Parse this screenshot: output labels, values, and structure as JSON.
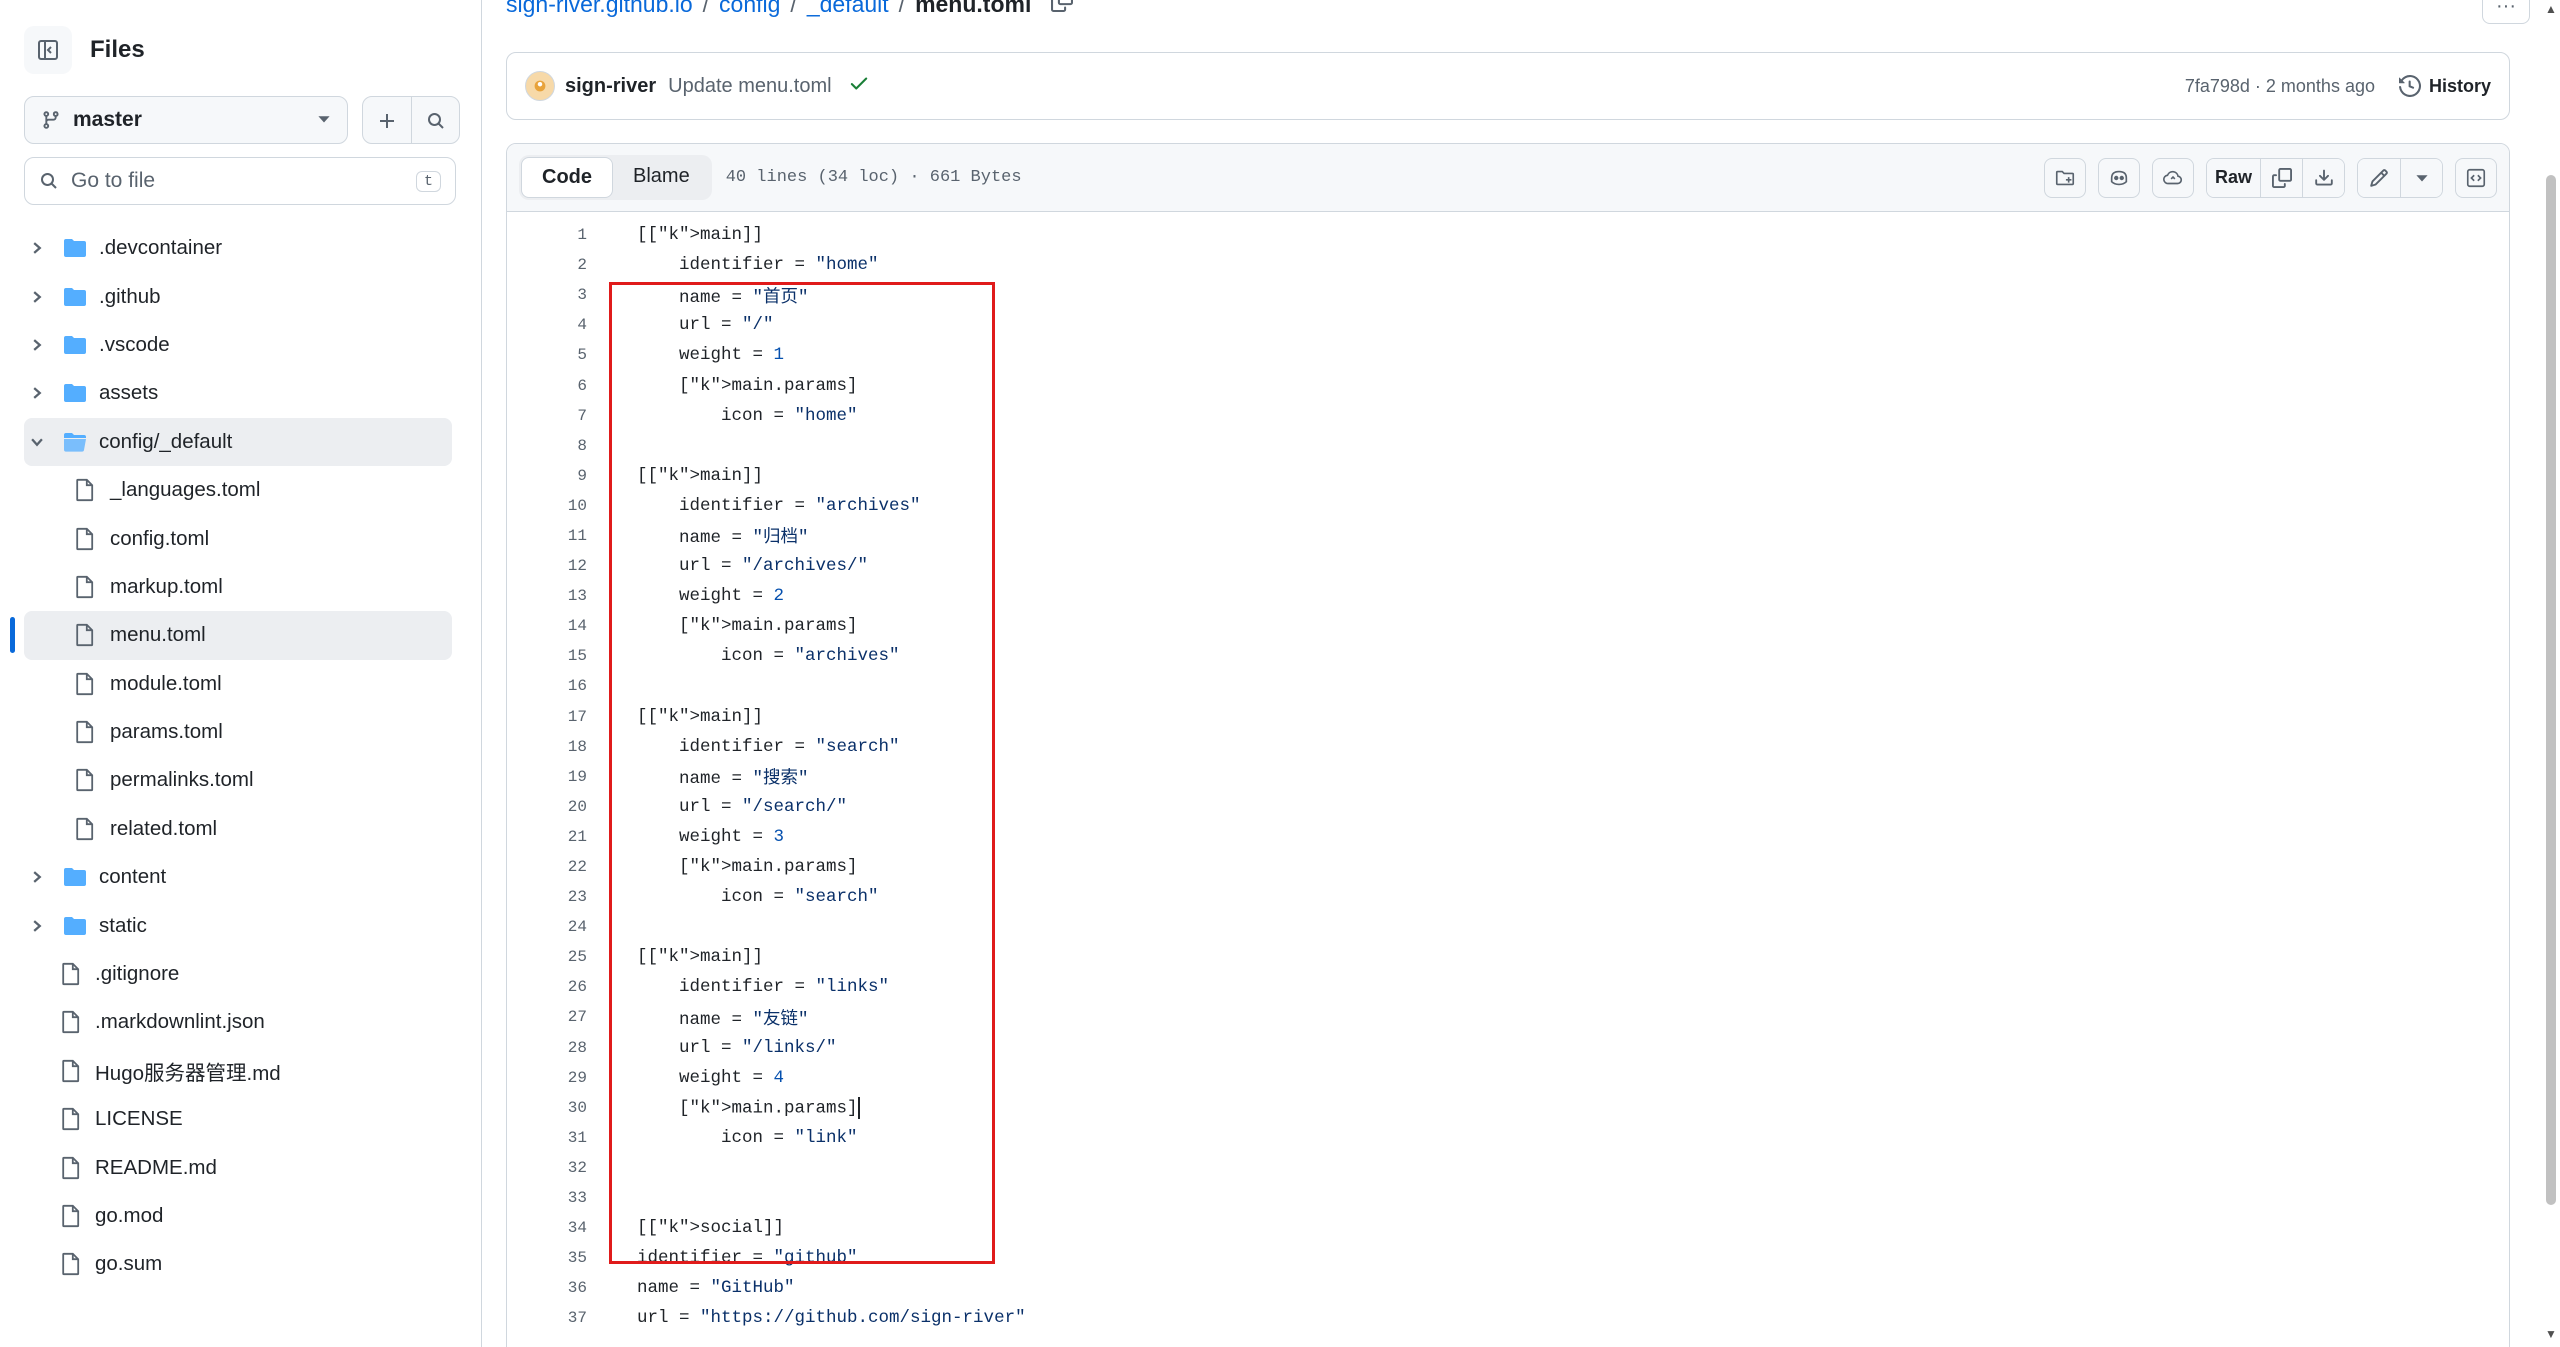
{
  "sidebar": {
    "title": "Files",
    "branch": "master",
    "search_placeholder": "Go to file",
    "search_shortcut": "t",
    "tree": [
      {
        "label": ".devcontainer",
        "type": "folder",
        "level": 0,
        "expanded": false
      },
      {
        "label": ".github",
        "type": "folder",
        "level": 0,
        "expanded": false
      },
      {
        "label": ".vscode",
        "type": "folder",
        "level": 0,
        "expanded": false
      },
      {
        "label": "assets",
        "type": "folder",
        "level": 0,
        "expanded": false
      },
      {
        "label": "config/_default",
        "type": "folder",
        "level": 0,
        "expanded": true
      },
      {
        "label": "_languages.toml",
        "type": "file",
        "level": 1
      },
      {
        "label": "config.toml",
        "type": "file",
        "level": 1
      },
      {
        "label": "markup.toml",
        "type": "file",
        "level": 1
      },
      {
        "label": "menu.toml",
        "type": "file",
        "level": 1,
        "selected": true
      },
      {
        "label": "module.toml",
        "type": "file",
        "level": 1
      },
      {
        "label": "params.toml",
        "type": "file",
        "level": 1
      },
      {
        "label": "permalinks.toml",
        "type": "file",
        "level": 1
      },
      {
        "label": "related.toml",
        "type": "file",
        "level": 1
      },
      {
        "label": "content",
        "type": "folder",
        "level": 0,
        "expanded": false
      },
      {
        "label": "static",
        "type": "folder",
        "level": 0,
        "expanded": false
      },
      {
        "label": ".gitignore",
        "type": "file",
        "level": 0
      },
      {
        "label": ".markdownlint.json",
        "type": "file",
        "level": 0
      },
      {
        "label": "Hugo服务器管理.md",
        "type": "file",
        "level": 0
      },
      {
        "label": "LICENSE",
        "type": "file",
        "level": 0
      },
      {
        "label": "README.md",
        "type": "file",
        "level": 0
      },
      {
        "label": "go.mod",
        "type": "file",
        "level": 0
      },
      {
        "label": "go.sum",
        "type": "file",
        "level": 0
      }
    ]
  },
  "breadcrumb": {
    "repo": "sign-river.github.io",
    "seg1": "config",
    "seg2": "_default",
    "current": "menu.toml",
    "sep": "/"
  },
  "commit": {
    "author": "sign-river",
    "message": "Update menu.toml",
    "meta": "7fa798d · 2 months ago",
    "history_label": "History"
  },
  "file": {
    "tab_code": "Code",
    "tab_blame": "Blame",
    "info": "40 lines (34 loc) · 661 Bytes",
    "raw_label": "Raw"
  },
  "code_lines": [
    "[[main]]",
    "    identifier = \"home\"",
    "    name = \"首页\"",
    "    url = \"/\"",
    "    weight = 1",
    "    [main.params]",
    "        icon = \"home\"",
    "",
    "[[main]]",
    "    identifier = \"archives\"",
    "    name = \"归档\"",
    "    url = \"/archives/\"",
    "    weight = 2",
    "    [main.params]",
    "        icon = \"archives\"",
    "",
    "[[main]]",
    "    identifier = \"search\"",
    "    name = \"搜索\"",
    "    url = \"/search/\"",
    "    weight = 3",
    "    [main.params]",
    "        icon = \"search\"",
    "",
    "[[main]]",
    "    identifier = \"links\"",
    "    name = \"友链\"",
    "    url = \"/links/\"",
    "    weight = 4",
    "    [main.params]",
    "        icon = \"link\"",
    "",
    "",
    "[[social]]",
    "identifier = \"github\"",
    "name = \"GitHub\"",
    "url = \"https://github.com/sign-river\""
  ],
  "colors": {
    "link": "#0969da",
    "highlight_border": "#e01b1b",
    "keyword": "#6f42c1",
    "string": "#0a3069",
    "number": "#0550ae",
    "success": "#1a7f37"
  }
}
